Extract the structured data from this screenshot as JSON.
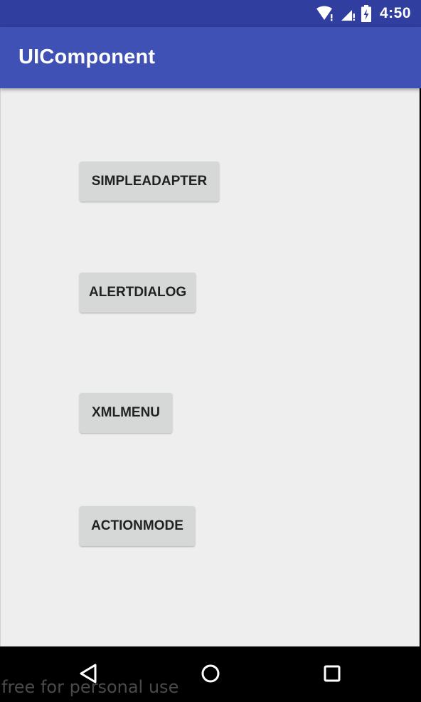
{
  "status_bar": {
    "time": "4:50",
    "icons": [
      "wifi-icon",
      "signal-icon",
      "battery-charging-icon"
    ]
  },
  "app_bar": {
    "title": "UIComponent"
  },
  "buttons": [
    {
      "label": "SIMPLEADAPTER"
    },
    {
      "label": "ALERTDIALOG"
    },
    {
      "label": "XMLMENU"
    },
    {
      "label": "ACTIONMODE"
    }
  ],
  "nav_bar": {
    "icons": [
      "back-icon",
      "home-icon",
      "recents-icon"
    ],
    "watermark": "free for personal use"
  },
  "colors": {
    "status_bar": "#303f9f",
    "app_bar": "#3f51b5",
    "content_bg": "#eeeeee",
    "button_bg": "#d6d7d7",
    "nav_bar": "#000000"
  }
}
